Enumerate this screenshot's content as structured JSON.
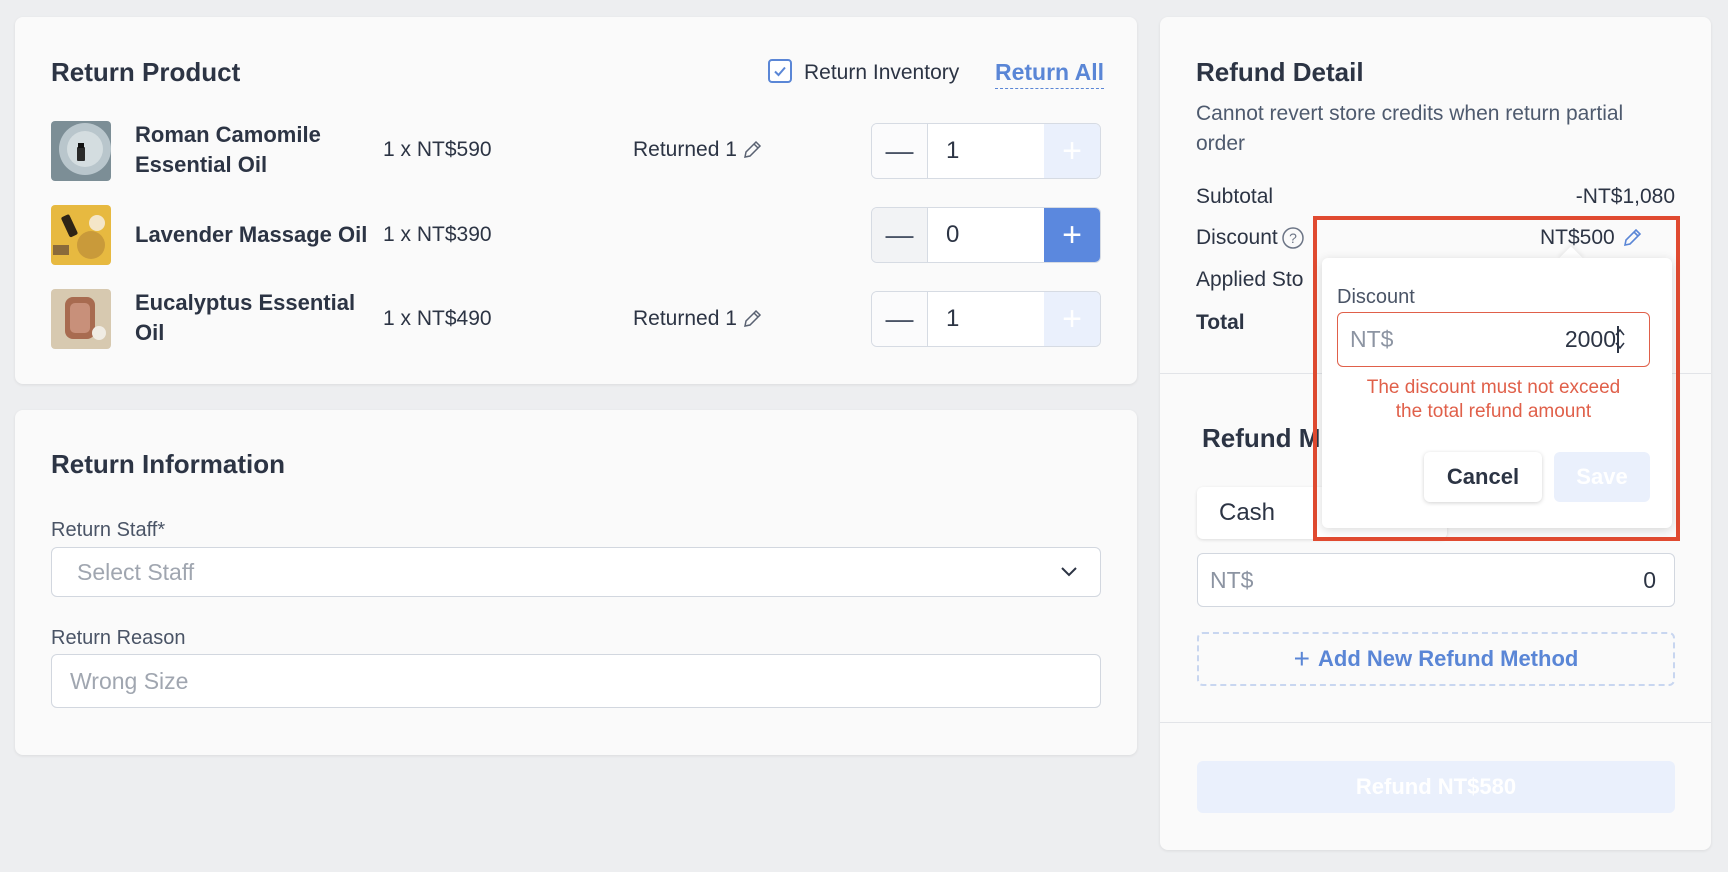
{
  "return_product": {
    "title": "Return Product",
    "return_inventory_label": "Return Inventory",
    "return_inventory_checked": true,
    "return_all_label": "Return All",
    "items": [
      {
        "name_line1": "Roman Camomile",
        "name_line2": "Essential Oil",
        "price": "1 x NT$590",
        "returned": "Returned 1",
        "qty": "1"
      },
      {
        "name_line1": "Lavender Massage Oil",
        "name_line2": "",
        "price": "1 x NT$390",
        "returned": "",
        "qty": "0"
      },
      {
        "name_line1": "Eucalyptus Essential",
        "name_line2": "Oil",
        "price": "1 x NT$490",
        "returned": "Returned 1",
        "qty": "1"
      }
    ]
  },
  "return_information": {
    "title": "Return Information",
    "staff_label": "Return Staff*",
    "staff_placeholder": "Select Staff",
    "reason_label": "Return Reason",
    "reason_placeholder": "Wrong Size"
  },
  "refund_detail": {
    "title": "Refund Detail",
    "note_line1": "Cannot revert store credits when return partial",
    "note_line2": "order",
    "subtotal_label": "Subtotal",
    "subtotal_value": "-NT$1,080",
    "discount_label": "Discount",
    "discount_value": "NT$500",
    "applied_label": "Applied Sto",
    "total_label": "Total",
    "method_title": "Refund M",
    "method_value": "Cash",
    "amount_prefix": "NT$",
    "amount_value": "0",
    "add_method_label": "Add New Refund Method",
    "refund_button": "Refund NT$580"
  },
  "discount_popover": {
    "label": "Discount",
    "prefix": "NT$",
    "value": "2000",
    "error_line1": "The discount must not exceed",
    "error_line2": "the total refund amount",
    "cancel_label": "Cancel",
    "save_label": "Save"
  },
  "colors": {
    "accent": "#5a86d6",
    "error": "#e0604a",
    "highlight": "#e04a30"
  }
}
